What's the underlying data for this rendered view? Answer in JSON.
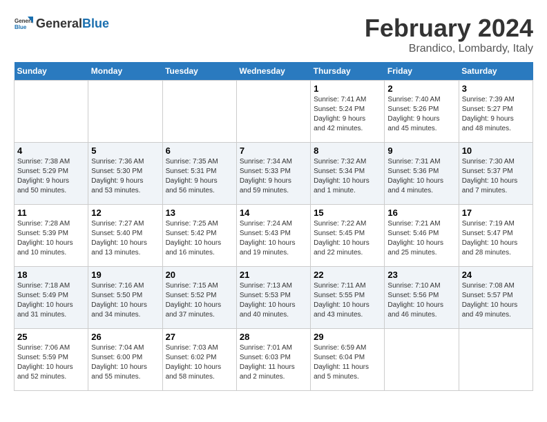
{
  "header": {
    "logo_general": "General",
    "logo_blue": "Blue",
    "main_title": "February 2024",
    "subtitle": "Brandico, Lombardy, Italy"
  },
  "calendar": {
    "days_of_week": [
      "Sunday",
      "Monday",
      "Tuesday",
      "Wednesday",
      "Thursday",
      "Friday",
      "Saturday"
    ],
    "weeks": [
      [
        {
          "day": "",
          "info": ""
        },
        {
          "day": "",
          "info": ""
        },
        {
          "day": "",
          "info": ""
        },
        {
          "day": "",
          "info": ""
        },
        {
          "day": "1",
          "info": "Sunrise: 7:41 AM\nSunset: 5:24 PM\nDaylight: 9 hours\nand 42 minutes."
        },
        {
          "day": "2",
          "info": "Sunrise: 7:40 AM\nSunset: 5:26 PM\nDaylight: 9 hours\nand 45 minutes."
        },
        {
          "day": "3",
          "info": "Sunrise: 7:39 AM\nSunset: 5:27 PM\nDaylight: 9 hours\nand 48 minutes."
        }
      ],
      [
        {
          "day": "4",
          "info": "Sunrise: 7:38 AM\nSunset: 5:29 PM\nDaylight: 9 hours\nand 50 minutes."
        },
        {
          "day": "5",
          "info": "Sunrise: 7:36 AM\nSunset: 5:30 PM\nDaylight: 9 hours\nand 53 minutes."
        },
        {
          "day": "6",
          "info": "Sunrise: 7:35 AM\nSunset: 5:31 PM\nDaylight: 9 hours\nand 56 minutes."
        },
        {
          "day": "7",
          "info": "Sunrise: 7:34 AM\nSunset: 5:33 PM\nDaylight: 9 hours\nand 59 minutes."
        },
        {
          "day": "8",
          "info": "Sunrise: 7:32 AM\nSunset: 5:34 PM\nDaylight: 10 hours\nand 1 minute."
        },
        {
          "day": "9",
          "info": "Sunrise: 7:31 AM\nSunset: 5:36 PM\nDaylight: 10 hours\nand 4 minutes."
        },
        {
          "day": "10",
          "info": "Sunrise: 7:30 AM\nSunset: 5:37 PM\nDaylight: 10 hours\nand 7 minutes."
        }
      ],
      [
        {
          "day": "11",
          "info": "Sunrise: 7:28 AM\nSunset: 5:39 PM\nDaylight: 10 hours\nand 10 minutes."
        },
        {
          "day": "12",
          "info": "Sunrise: 7:27 AM\nSunset: 5:40 PM\nDaylight: 10 hours\nand 13 minutes."
        },
        {
          "day": "13",
          "info": "Sunrise: 7:25 AM\nSunset: 5:42 PM\nDaylight: 10 hours\nand 16 minutes."
        },
        {
          "day": "14",
          "info": "Sunrise: 7:24 AM\nSunset: 5:43 PM\nDaylight: 10 hours\nand 19 minutes."
        },
        {
          "day": "15",
          "info": "Sunrise: 7:22 AM\nSunset: 5:45 PM\nDaylight: 10 hours\nand 22 minutes."
        },
        {
          "day": "16",
          "info": "Sunrise: 7:21 AM\nSunset: 5:46 PM\nDaylight: 10 hours\nand 25 minutes."
        },
        {
          "day": "17",
          "info": "Sunrise: 7:19 AM\nSunset: 5:47 PM\nDaylight: 10 hours\nand 28 minutes."
        }
      ],
      [
        {
          "day": "18",
          "info": "Sunrise: 7:18 AM\nSunset: 5:49 PM\nDaylight: 10 hours\nand 31 minutes."
        },
        {
          "day": "19",
          "info": "Sunrise: 7:16 AM\nSunset: 5:50 PM\nDaylight: 10 hours\nand 34 minutes."
        },
        {
          "day": "20",
          "info": "Sunrise: 7:15 AM\nSunset: 5:52 PM\nDaylight: 10 hours\nand 37 minutes."
        },
        {
          "day": "21",
          "info": "Sunrise: 7:13 AM\nSunset: 5:53 PM\nDaylight: 10 hours\nand 40 minutes."
        },
        {
          "day": "22",
          "info": "Sunrise: 7:11 AM\nSunset: 5:55 PM\nDaylight: 10 hours\nand 43 minutes."
        },
        {
          "day": "23",
          "info": "Sunrise: 7:10 AM\nSunset: 5:56 PM\nDaylight: 10 hours\nand 46 minutes."
        },
        {
          "day": "24",
          "info": "Sunrise: 7:08 AM\nSunset: 5:57 PM\nDaylight: 10 hours\nand 49 minutes."
        }
      ],
      [
        {
          "day": "25",
          "info": "Sunrise: 7:06 AM\nSunset: 5:59 PM\nDaylight: 10 hours\nand 52 minutes."
        },
        {
          "day": "26",
          "info": "Sunrise: 7:04 AM\nSunset: 6:00 PM\nDaylight: 10 hours\nand 55 minutes."
        },
        {
          "day": "27",
          "info": "Sunrise: 7:03 AM\nSunset: 6:02 PM\nDaylight: 10 hours\nand 58 minutes."
        },
        {
          "day": "28",
          "info": "Sunrise: 7:01 AM\nSunset: 6:03 PM\nDaylight: 11 hours\nand 2 minutes."
        },
        {
          "day": "29",
          "info": "Sunrise: 6:59 AM\nSunset: 6:04 PM\nDaylight: 11 hours\nand 5 minutes."
        },
        {
          "day": "",
          "info": ""
        },
        {
          "day": "",
          "info": ""
        }
      ]
    ]
  }
}
